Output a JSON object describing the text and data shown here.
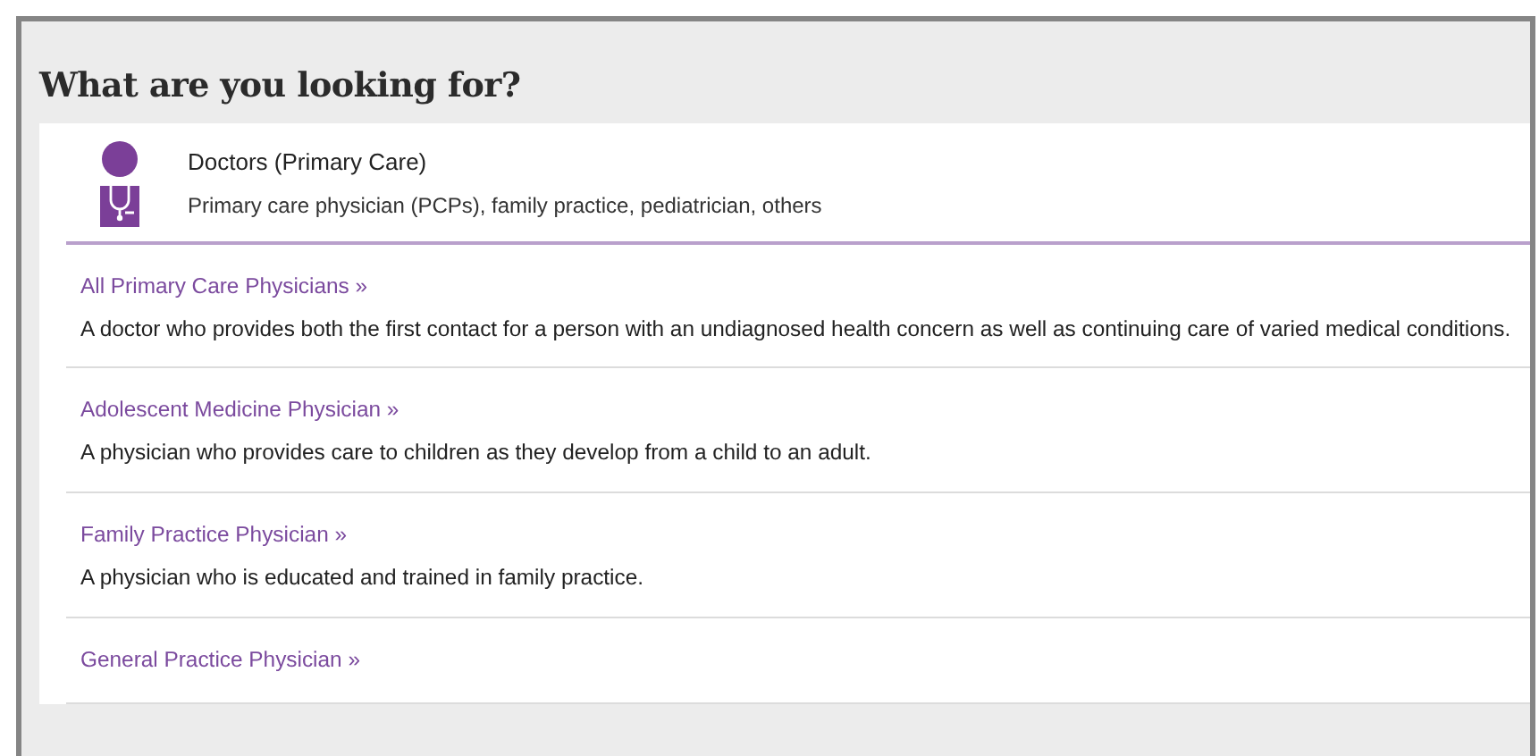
{
  "heading": "What are you looking for?",
  "category": {
    "title": "Doctors (Primary Care)",
    "subtitle": "Primary care physician (PCPs), family practice, pediatrician, others"
  },
  "items": [
    {
      "link": "All Primary Care Physicians »",
      "description": "A doctor who provides both the first contact for a person with an undiagnosed health concern as well as continuing care of varied medical conditions."
    },
    {
      "link": "Adolescent Medicine Physician »",
      "description": "A physician who provides care to children as they develop from a child to an adult."
    },
    {
      "link": "Family Practice Physician »",
      "description": "A physician who is educated and trained in family practice."
    },
    {
      "link": "General Practice Physician »"
    }
  ]
}
